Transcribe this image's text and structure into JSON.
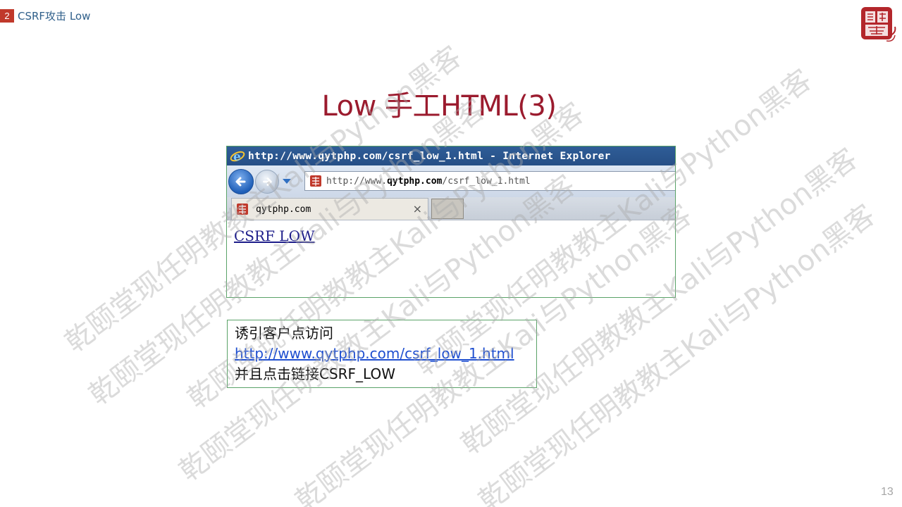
{
  "header": {
    "section_number": "2",
    "section_title": "CSRF攻击 Low"
  },
  "slide": {
    "title": "Low 手工HTML(3)",
    "page_number": "13"
  },
  "browser": {
    "window_title": "http://www.qytphp.com/csrf_low_1.html - Internet Explorer",
    "address_prefix": "http://www.",
    "address_domain": "qytphp.com",
    "address_path": "/csrf_low_1.html",
    "tab_label": "qytphp.com",
    "tab_close": "×",
    "page_link": "CSRF LOW"
  },
  "note": {
    "line1": "诱引客户点访问",
    "link": "http://www.qytphp.com/csrf_low_1.html",
    "line3": "并且点击链接CSRF_LOW"
  },
  "watermark": {
    "text": "乾颐堂现任明教教主Kali与Python黑客"
  },
  "colors": {
    "title": "#9b1b2e",
    "section_badge": "#c0392b",
    "section_text": "#2f5f8a",
    "frame_border": "#5aa368",
    "link": "#1f4fd0"
  }
}
